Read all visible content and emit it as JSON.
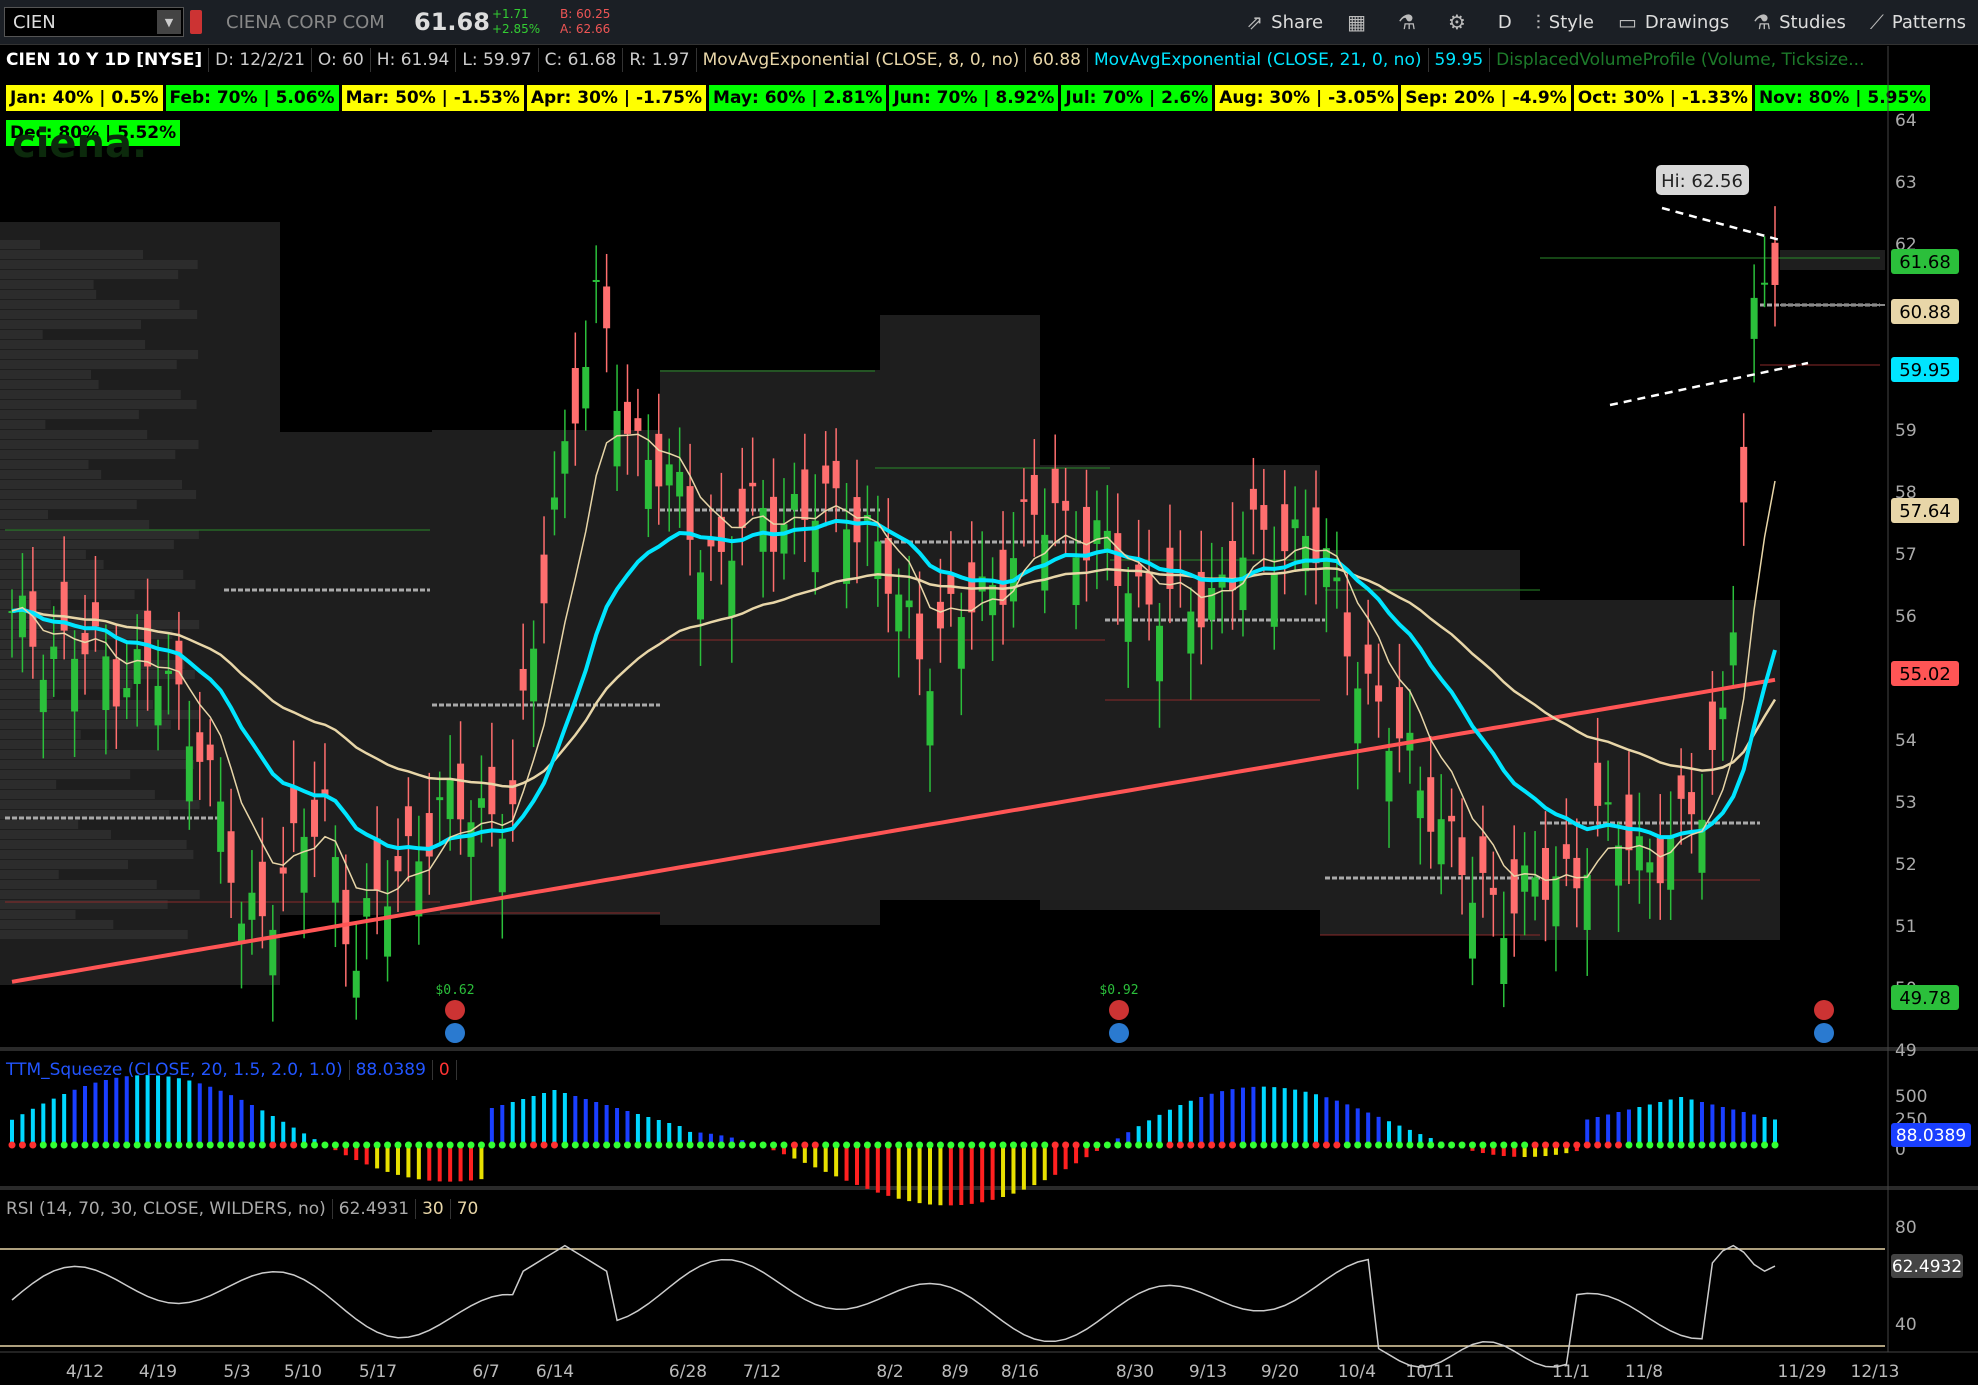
{
  "header": {
    "symbol": "CIEN",
    "company": "CIENA CORP COM",
    "last": "61.68",
    "change": "+1.71",
    "change_pct": "+2.85%",
    "bid": "B: 60.25",
    "ask": "A: 62.66",
    "share": "Share",
    "aggregation": "D",
    "style": "Style",
    "drawings": "Drawings",
    "studies": "Studies",
    "patterns": "Patterns"
  },
  "infobar": {
    "title": "CIEN 10 Y 1D [NYSE]",
    "date": "D: 12/2/21",
    "open": "O: 60",
    "high": "H: 61.94",
    "low": "L: 59.97",
    "close": "C: 61.68",
    "range": "R: 1.97",
    "ema8_label": "MovAvgExponential (CLOSE, 8, 0, no)",
    "ema8_value": "60.88",
    "ema21_label": "MovAvgExponential (CLOSE, 21, 0, no)",
    "ema21_value": "59.95",
    "dvp_label": "DisplacedVolumeProfile (Volume, Ticksize..."
  },
  "seasonality": [
    {
      "text": "Jan: 40% | 0.5%",
      "color": "#ffff00"
    },
    {
      "text": "Feb: 70% | 5.06%",
      "color": "#00ff00"
    },
    {
      "text": "Mar: 50% | -1.53%",
      "color": "#ffff00"
    },
    {
      "text": "Apr: 30% | -1.75%",
      "color": "#ffff00"
    },
    {
      "text": "May: 60% | 2.81%",
      "color": "#00ff00"
    },
    {
      "text": "Jun: 70% | 8.92%",
      "color": "#00ff00"
    },
    {
      "text": "Jul: 70% | 2.6%",
      "color": "#00ff00"
    },
    {
      "text": "Aug: 30% | -3.05%",
      "color": "#ffff00"
    },
    {
      "text": "Sep: 20% | -4.9%",
      "color": "#ffff00"
    },
    {
      "text": "Oct: 30% | -1.33%",
      "color": "#ffff00"
    },
    {
      "text": "Nov: 80% | 5.95%",
      "color": "#00ff00"
    },
    {
      "text": "Dec: 80% | 5.52%",
      "color": "#00ff00"
    }
  ],
  "price_axis": {
    "ticks": [
      "64",
      "63",
      "62",
      "61",
      "60",
      "59",
      "58",
      "57",
      "56",
      "55",
      "54",
      "53",
      "52",
      "51",
      "50",
      "49"
    ],
    "bubbles": [
      {
        "text": "61.68",
        "color": "#2bbf3b"
      },
      {
        "text": "60.88",
        "color": "#e8d6a8"
      },
      {
        "text": "59.95",
        "color": "#00e5ff"
      },
      {
        "text": "57.64",
        "color": "#e8d6a8"
      },
      {
        "text": "55.02",
        "color": "#ff5555"
      },
      {
        "text": "49.78",
        "color": "#2bbf3b"
      }
    ]
  },
  "annotations": {
    "hi_label": "Hi: 62.56",
    "dividend_1": "$0.62",
    "dividend_2": "$0.92"
  },
  "squeeze": {
    "label": "TTM_Squeeze (CLOSE, 20, 1.5, 2.0, 1.0)",
    "value": "88.0389",
    "value2": "0",
    "ticks": [
      "500",
      "250",
      "0"
    ],
    "bubble": "88.0389"
  },
  "rsi": {
    "label": "RSI (14, 70, 30, CLOSE, WILDERS, no)",
    "value": "62.4931",
    "os": "30",
    "ob": "70",
    "ticks": [
      "80",
      "40"
    ],
    "bubble": "62.4932"
  },
  "time_axis": [
    "4/12",
    "4/19",
    "5/3",
    "5/10",
    "5/17",
    "6/7",
    "6/14",
    "6/28",
    "7/12",
    "8/2",
    "8/9",
    "8/16",
    "8/30",
    "9/13",
    "9/20",
    "10/4",
    "10/11",
    "11/1",
    "11/8",
    "11/29",
    "12/13"
  ],
  "colors": {
    "up": "#2bbf3b",
    "down": "#ff6e6e",
    "ema8": "#e8d6a8",
    "ema21": "#00e5ff",
    "sma": "#ff5555"
  }
}
